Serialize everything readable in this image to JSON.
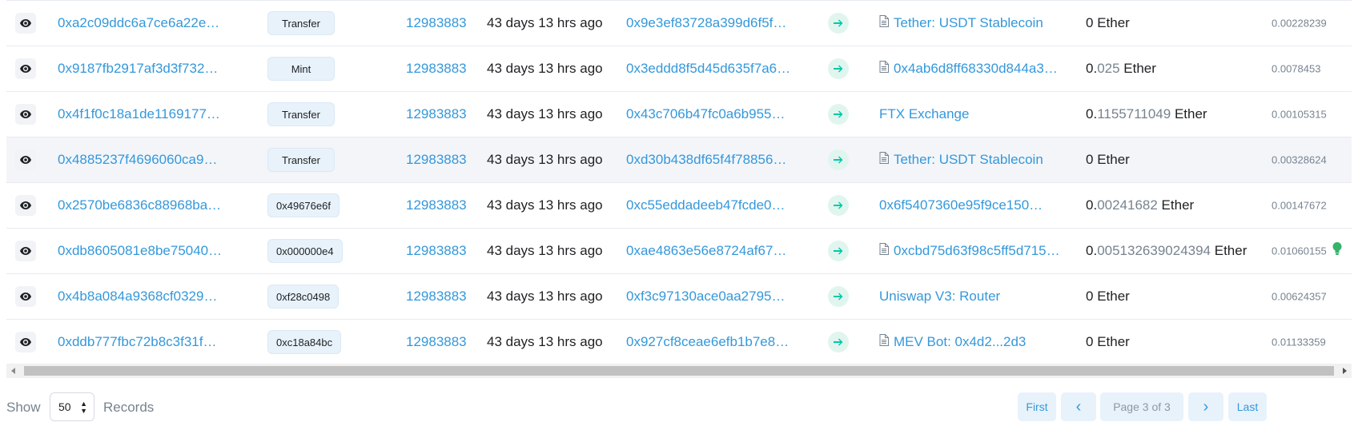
{
  "transactions": [
    {
      "hash": "0xa2c09ddc6a7ce6a22e…",
      "method": "Transfer",
      "block": "12983883",
      "age": "43 days 13 hrs ago",
      "from": "0x9e3ef83728a399d6f5f…",
      "to": "Tether: USDT Stablecoin",
      "to_contract": true,
      "value_main": "0",
      "value_muted": "",
      "value_unit": " Ether",
      "fee": "0.00228239",
      "highlighted": false
    },
    {
      "hash": "0x9187fb2917af3d3f732…",
      "method": "Mint",
      "block": "12983883",
      "age": "43 days 13 hrs ago",
      "from": "0x3eddd8f5d45d635f7a6…",
      "to": "0x4ab6d8ff68330d844a3…",
      "to_contract": true,
      "value_main": "0.",
      "value_muted": "025",
      "value_unit": " Ether",
      "fee": "0.0078453",
      "highlighted": false
    },
    {
      "hash": "0x4f1f0c18a1de1169177…",
      "method": "Transfer",
      "block": "12983883",
      "age": "43 days 13 hrs ago",
      "from": "0x43c706b47fc0a6b955…",
      "to": "FTX Exchange",
      "to_contract": false,
      "value_main": "0.",
      "value_muted": "1155711049",
      "value_unit": " Ether",
      "fee": "0.00105315",
      "highlighted": false
    },
    {
      "hash": "0x4885237f4696060ca9…",
      "method": "Transfer",
      "block": "12983883",
      "age": "43 days 13 hrs ago",
      "from": "0xd30b438df65f4f78856…",
      "to": "Tether: USDT Stablecoin",
      "to_contract": true,
      "value_main": "0",
      "value_muted": "",
      "value_unit": " Ether",
      "fee": "0.00328624",
      "highlighted": true
    },
    {
      "hash": "0x2570be6836c88968ba…",
      "method": "0x49676e6f",
      "block": "12983883",
      "age": "43 days 13 hrs ago",
      "from": "0xc55eddadeeb47fcde0…",
      "to": "0x6f5407360e95f9ce150…",
      "to_contract": false,
      "value_main": "0.",
      "value_muted": "00241682",
      "value_unit": " Ether",
      "fee": "0.00147672",
      "highlighted": false
    },
    {
      "hash": "0xdb8605081e8be75040…",
      "method": "0x000000e4",
      "block": "12983883",
      "age": "43 days 13 hrs ago",
      "from": "0xae4863e56e8724af67…",
      "to": "0xcbd75d63f98c5ff5d715…",
      "to_contract": true,
      "value_main": "0.",
      "value_muted": "005132639024394",
      "value_unit": " Ether",
      "fee": "0.01060155",
      "highlighted": false,
      "has_bulb": true
    },
    {
      "hash": "0x4b8a084a9368cf0329…",
      "method": "0xf28c0498",
      "block": "12983883",
      "age": "43 days 13 hrs ago",
      "from": "0xf3c97130ace0aa2795…",
      "to": "Uniswap V3: Router",
      "to_contract": false,
      "value_main": "0",
      "value_muted": "",
      "value_unit": " Ether",
      "fee": "0.00624357",
      "highlighted": false
    },
    {
      "hash": "0xddb777fbc72b8c3f31f…",
      "method": "0xc18a84bc",
      "block": "12983883",
      "age": "43 days 13 hrs ago",
      "from": "0x927cf8ceae6efb1b7e8…",
      "to": "MEV Bot: 0x4d2...2d3",
      "to_contract": true,
      "value_main": "0",
      "value_muted": "",
      "value_unit": " Ether",
      "fee": "0.01133359",
      "highlighted": false
    }
  ],
  "footer": {
    "show_label": "Show",
    "page_size": "50",
    "records_label": "Records"
  },
  "pagination": {
    "first": "First",
    "prev": "‹",
    "page_info": "Page 3 of 3",
    "next": "›",
    "last": "Last"
  },
  "icons": {
    "row_view": "eye-icon",
    "direction": "arrow-right-icon",
    "contract": "document-icon",
    "bulb": "lightbulb-icon"
  },
  "colors": {
    "link": "#3498db",
    "muted": "#77838f",
    "arrow_bg": "#e1f5ef",
    "arrow_fg": "#00c9a7",
    "badge_bg": "#e8f2fb"
  }
}
